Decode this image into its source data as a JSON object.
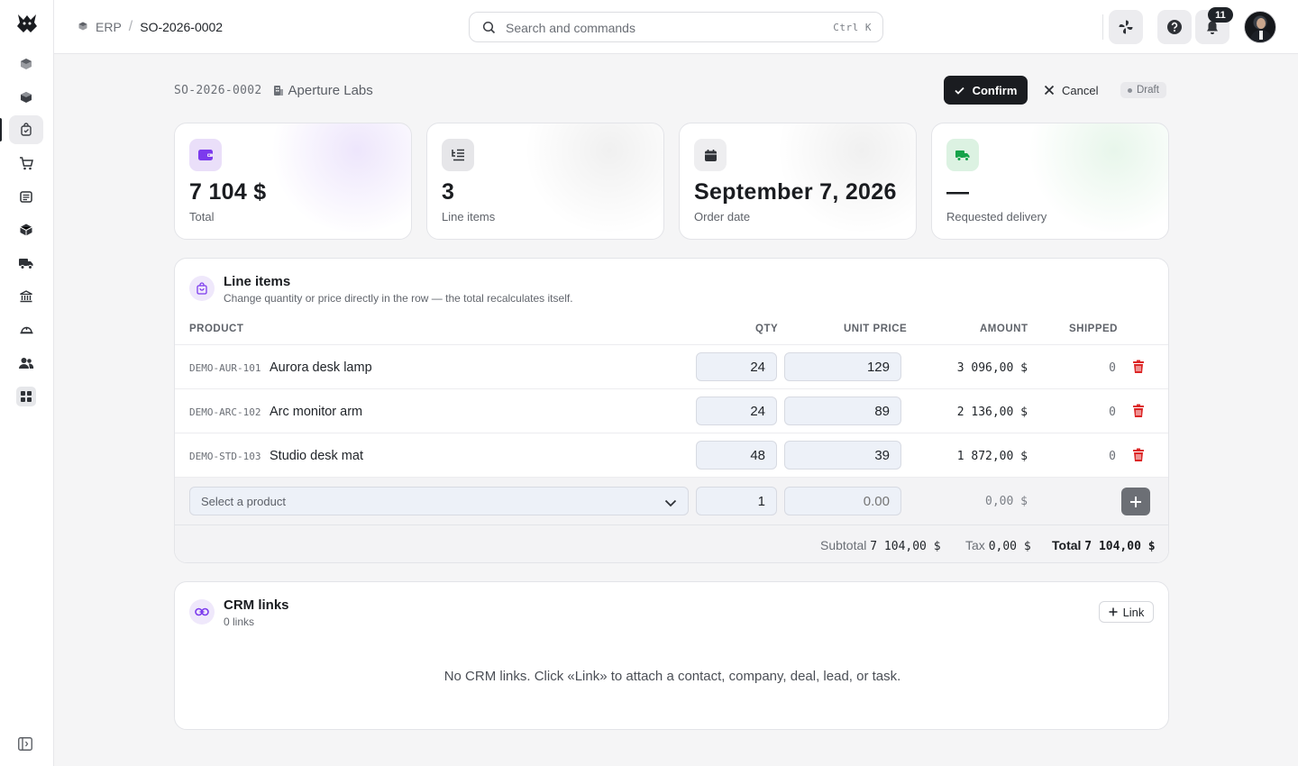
{
  "breadcrumb": {
    "root": "ERP",
    "current": "SO-2026-0002"
  },
  "search": {
    "placeholder": "Search and commands",
    "shortcut": "Ctrl K"
  },
  "notifications": {
    "count": "11"
  },
  "order": {
    "number": "SO-2026-0002",
    "customer": "Aperture Labs",
    "status": "Draft",
    "confirm_label": "Confirm",
    "cancel_label": "Cancel"
  },
  "stats": {
    "total": {
      "value": "7 104 $",
      "label": "Total"
    },
    "line_items": {
      "value": "3",
      "label": "Line items"
    },
    "order_date": {
      "value": "September 7, 2026",
      "label": "Order date"
    },
    "delivery": {
      "value": "—",
      "label": "Requested delivery"
    }
  },
  "line_items": {
    "title": "Line items",
    "subtitle": "Change quantity or price directly in the row — the total recalculates itself.",
    "columns": {
      "product": "PRODUCT",
      "qty": "QTY",
      "unit_price": "UNIT PRICE",
      "amount": "AMOUNT",
      "shipped": "SHIPPED"
    },
    "rows": [
      {
        "sku": "DEMO-AUR-101",
        "name": "Aurora desk lamp",
        "qty": "24",
        "price": "129",
        "amount": "3 096,00 $",
        "shipped": "0"
      },
      {
        "sku": "DEMO-ARC-102",
        "name": "Arc monitor arm",
        "qty": "24",
        "price": "89",
        "amount": "2 136,00 $",
        "shipped": "0"
      },
      {
        "sku": "DEMO-STD-103",
        "name": "Studio desk mat",
        "qty": "48",
        "price": "39",
        "amount": "1 872,00 $",
        "shipped": "0"
      }
    ],
    "new_row": {
      "product_placeholder": "Select a product",
      "qty": "1",
      "price_placeholder": "0.00",
      "amount": "0,00 $"
    },
    "totals": {
      "subtotal_label": "Subtotal",
      "subtotal": "7 104,00 $",
      "tax_label": "Tax",
      "tax": "0,00 $",
      "total_label": "Total",
      "total": "7 104,00 $"
    }
  },
  "crm": {
    "title": "CRM links",
    "count": "0 links",
    "link_label": "Link",
    "empty": "No CRM links. Click «Link» to attach a contact, company, deal, lead, or task."
  },
  "colors": {
    "accent": "#7c3aed",
    "danger": "#dc2626",
    "success": "#16a34a"
  }
}
